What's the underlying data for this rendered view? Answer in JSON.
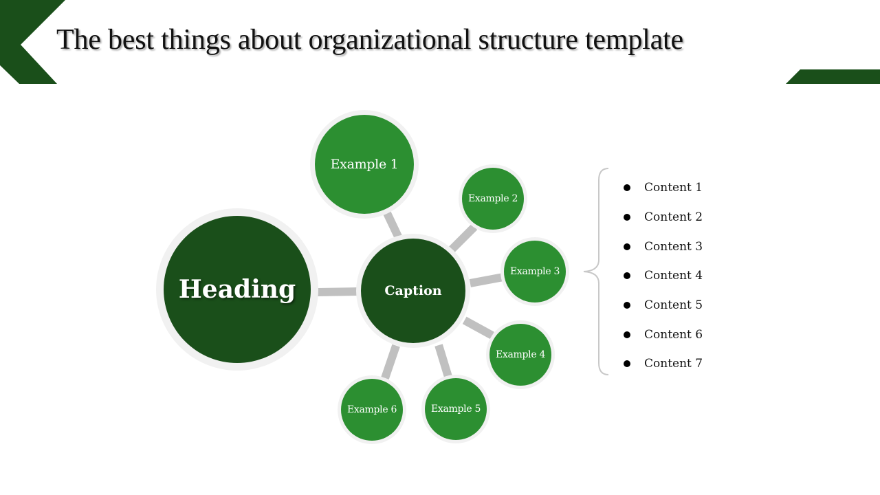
{
  "title": "The best things about organizational structure template",
  "colors": {
    "dark_green": "#1a4f1a",
    "light_green": "#2c8f31",
    "ring": "#f1f1f1",
    "connector": "#c0c0c0"
  },
  "diagram": {
    "heading": "Heading",
    "caption": "Caption",
    "examples": [
      {
        "label": "Example 1"
      },
      {
        "label": "Example 2"
      },
      {
        "label": "Example 3"
      },
      {
        "label": "Example 4"
      },
      {
        "label": "Example 5"
      },
      {
        "label": "Example 6"
      }
    ]
  },
  "content_list": {
    "items": [
      "Content 1",
      "Content 2",
      "Content 3",
      "Content 4",
      "Content 5",
      "Content 6",
      "Content 7"
    ]
  }
}
